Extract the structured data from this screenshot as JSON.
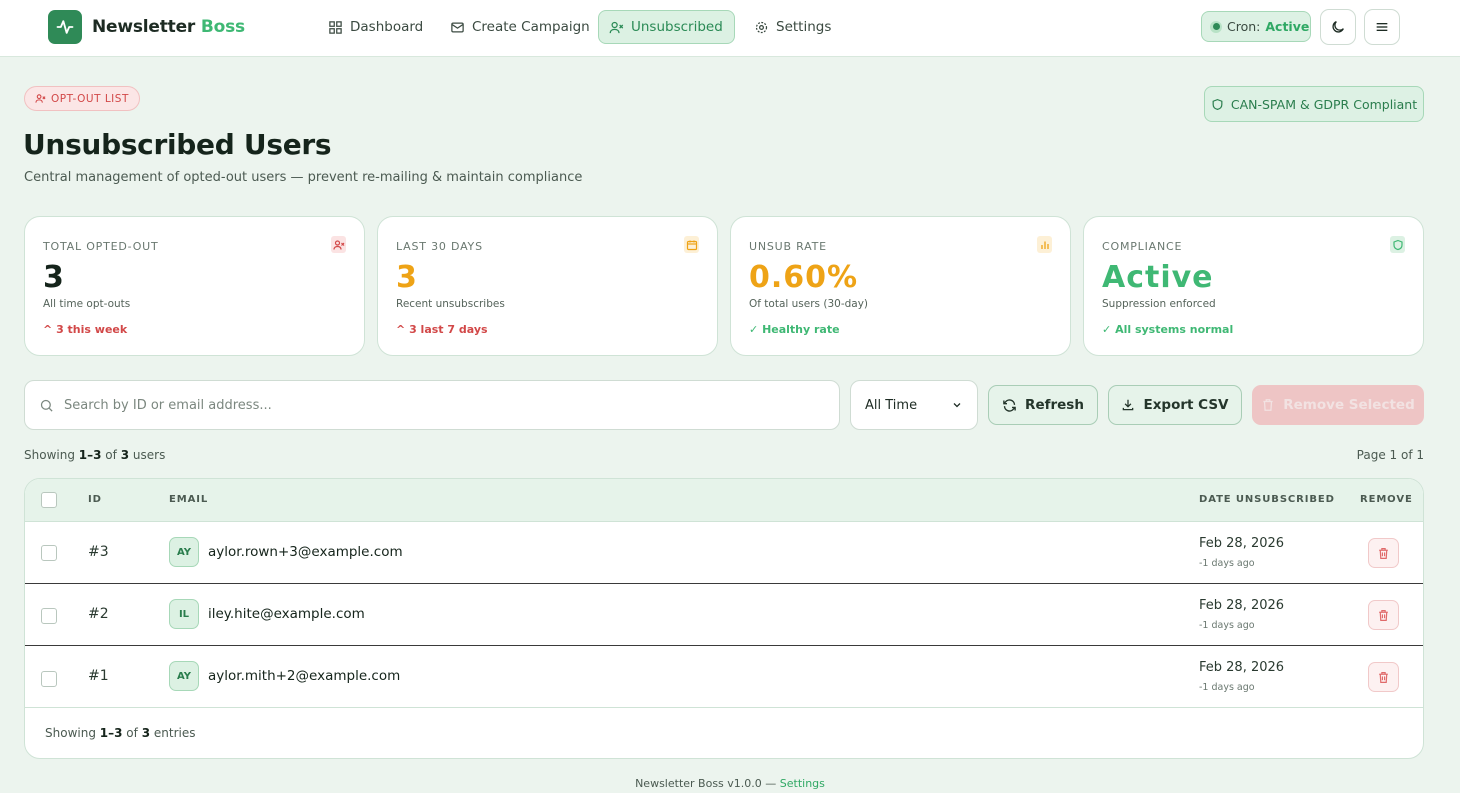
{
  "brand": {
    "name_part1": "Newsletter",
    "name_part2": "Boss"
  },
  "nav": [
    {
      "label": "Dashboard",
      "icon": "grid-icon"
    },
    {
      "label": "Create Campaign",
      "icon": "mail-icon"
    },
    {
      "label": "Unsubscribed",
      "icon": "user-x-icon",
      "active": true
    },
    {
      "label": "Settings",
      "icon": "gear-icon"
    }
  ],
  "cron": {
    "label": "Cron:",
    "status": "Active"
  },
  "header": {
    "badge": "OPT-OUT LIST",
    "compliance_badge": "CAN-SPAM & GDPR Compliant",
    "title": "Unsubscribed Users",
    "subtitle": "Central management of opted-out users — prevent re-mailing & maintain compliance"
  },
  "stats": [
    {
      "label": "TOTAL OPTED-OUT",
      "value": "3",
      "desc": "All time opt-outs",
      "trend": "3 this week",
      "trend_prefix": "^",
      "color": "#15241b",
      "trend_color": "#d24848",
      "icon": "user-x-icon"
    },
    {
      "label": "LAST 30 DAYS",
      "value": "3",
      "desc": "Recent unsubscribes",
      "trend": "3 last 7 days",
      "trend_prefix": "^",
      "color": "#eea316",
      "trend_color": "#d24848",
      "icon": "calendar-icon"
    },
    {
      "label": "UNSUB RATE",
      "value": "0.60%",
      "desc": "Of total users (30-day)",
      "trend": "Healthy rate",
      "trend_prefix": "✓",
      "color": "#eea316",
      "trend_color": "#3fb874",
      "icon": "bar-chart-icon"
    },
    {
      "label": "COMPLIANCE",
      "value": "Active",
      "desc": "Suppression enforced",
      "trend": "All systems normal",
      "trend_prefix": "✓",
      "color": "#3fb874",
      "trend_color": "#3fb874",
      "icon": "shield-icon"
    }
  ],
  "toolbar": {
    "search_placeholder": "Search by ID or email address...",
    "filter_value": "All Time",
    "refresh_label": "Refresh",
    "export_label": "Export CSV",
    "remove_label": "Remove Selected"
  },
  "listing": {
    "showing_prefix": "Showing",
    "range": "1–3",
    "of": "of",
    "total": "3",
    "unit": "users",
    "page": "Page 1 of 1"
  },
  "table": {
    "headers": {
      "id": "ID",
      "email": "EMAIL",
      "date": "DATE UNSUBSCRIBED",
      "remove": "REMOVE"
    },
    "rows": [
      {
        "id": "#3",
        "initials": "AY",
        "email": "aylor.rown+3@example.com",
        "date": "Feb 28, 2026",
        "ago": "-1 days ago"
      },
      {
        "id": "#2",
        "initials": "IL",
        "email": "iley.hite@example.com",
        "date": "Feb 28, 2026",
        "ago": "-1 days ago"
      },
      {
        "id": "#1",
        "initials": "AY",
        "email": "aylor.mith+2@example.com",
        "date": "Feb 28, 2026",
        "ago": "-1 days ago"
      }
    ],
    "footer": {
      "prefix": "Showing",
      "range": "1–3",
      "of": "of",
      "total": "3",
      "unit": "entries"
    }
  },
  "footer": {
    "text": "Newsletter Boss v1.0.0 —",
    "link": "Settings"
  }
}
